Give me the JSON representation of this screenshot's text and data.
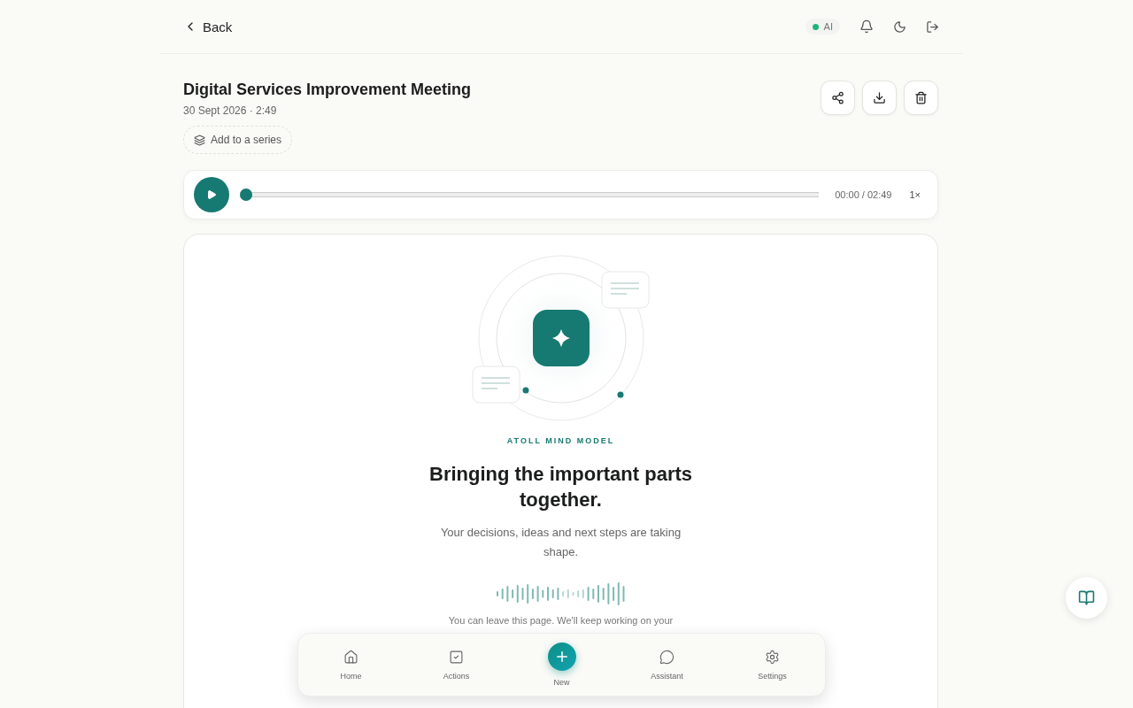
{
  "header": {
    "back": "Back",
    "ai_badge": {
      "label": "AI",
      "on": true
    }
  },
  "meeting": {
    "title": "Digital Services Improvement Meeting",
    "meta": "30 Sept 2026 · 2:49",
    "series_button": "Add to a series"
  },
  "player": {
    "level": 0,
    "time": "00:00 / 02:49",
    "speed": "1×"
  },
  "processing": {
    "eyebrow": "ATOLL MIND MODEL",
    "heading": "Bringing the important parts together.",
    "body": "Your decisions, ideas and next steps are taking shape.",
    "note": "You can leave this page. We'll keep working on your"
  },
  "bottom_nav": [
    {
      "label": "Home",
      "kind": "home",
      "selected": false
    },
    {
      "label": "Actions",
      "kind": "actions",
      "selected": false
    },
    {
      "label": "New",
      "kind": "new",
      "selected": false
    },
    {
      "label": "Assistant",
      "kind": "assistant",
      "selected": false
    },
    {
      "label": "Settings",
      "kind": "settings",
      "selected": false
    }
  ]
}
